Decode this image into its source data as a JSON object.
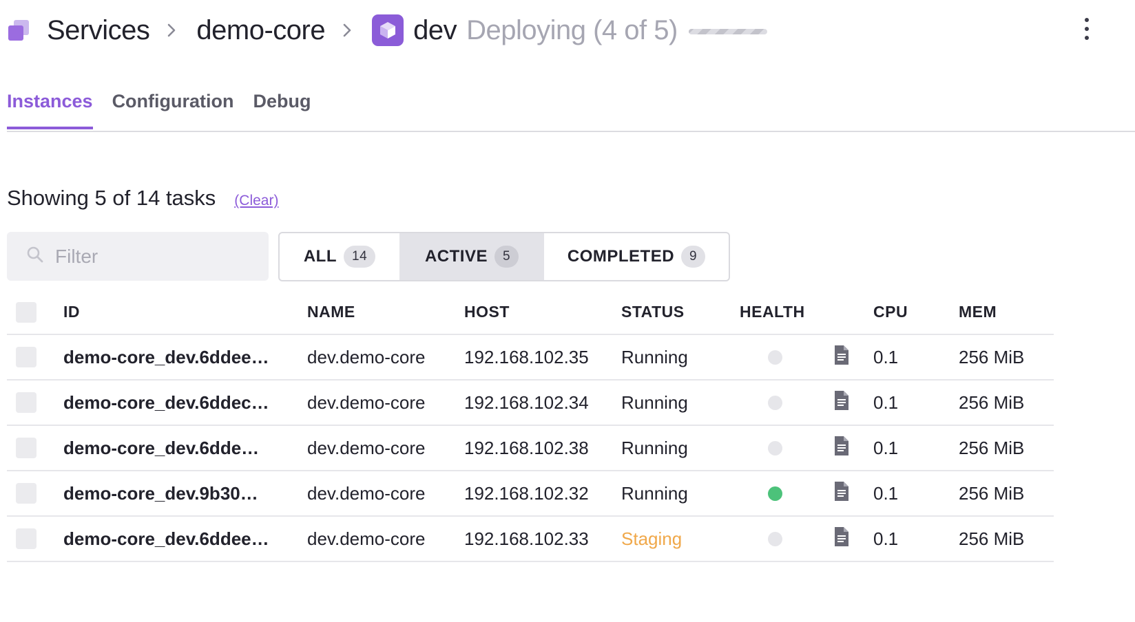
{
  "breadcrumb": {
    "services": "Services",
    "service": "demo-core",
    "env": "dev",
    "status": "Deploying (4 of 5)"
  },
  "tabs": [
    {
      "label": "Instances",
      "active": true
    },
    {
      "label": "Configuration",
      "active": false
    },
    {
      "label": "Debug",
      "active": false
    }
  ],
  "summary": {
    "text": "Showing 5 of 14 tasks",
    "clear": "(Clear)"
  },
  "filter": {
    "placeholder": "Filter",
    "value": ""
  },
  "segments": [
    {
      "label": "ALL",
      "count": "14"
    },
    {
      "label": "ACTIVE",
      "count": "5",
      "selected": true
    },
    {
      "label": "COMPLETED",
      "count": "9"
    }
  ],
  "table": {
    "headers": {
      "id": "ID",
      "name": "NAME",
      "host": "HOST",
      "status": "STATUS",
      "health": "HEALTH",
      "cpu": "CPU",
      "mem": "MEM"
    },
    "rows": [
      {
        "id": "demo-core_dev.6ddee…",
        "name": "dev.demo-core",
        "host": "192.168.102.35",
        "status": "Running",
        "health": "unknown",
        "cpu": "0.1",
        "mem": "256 MiB"
      },
      {
        "id": "demo-core_dev.6ddec…",
        "name": "dev.demo-core",
        "host": "192.168.102.34",
        "status": "Running",
        "health": "unknown",
        "cpu": "0.1",
        "mem": "256 MiB"
      },
      {
        "id": "demo-core_dev.6dde…",
        "name": "dev.demo-core",
        "host": "192.168.102.38",
        "status": "Running",
        "health": "unknown",
        "cpu": "0.1",
        "mem": "256 MiB"
      },
      {
        "id": "demo-core_dev.9b30…",
        "name": "dev.demo-core",
        "host": "192.168.102.32",
        "status": "Running",
        "health": "healthy",
        "cpu": "0.1",
        "mem": "256 MiB"
      },
      {
        "id": "demo-core_dev.6ddee…",
        "name": "dev.demo-core",
        "host": "192.168.102.33",
        "status": "Staging",
        "health": "unknown",
        "cpu": "0.1",
        "mem": "256 MiB"
      }
    ]
  },
  "colors": {
    "accent": "#8c5bd9",
    "healthy": "#4cc27a",
    "unknown": "#e6e6ea",
    "staging": "#f0a84a"
  },
  "icons": {
    "services": "services-icon",
    "service": "cube-icon",
    "search": "search-icon",
    "logs": "document-icon",
    "more": "more-vertical-icon"
  }
}
